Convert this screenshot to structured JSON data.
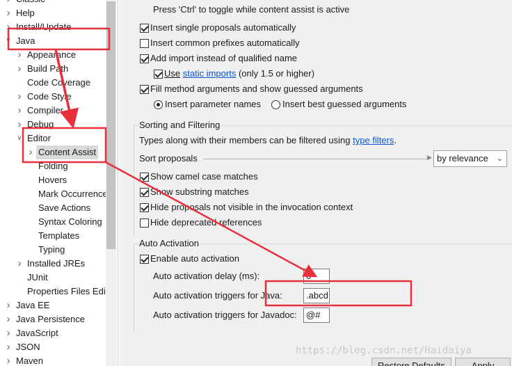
{
  "tree": {
    "items": [
      {
        "label": "Classic",
        "level": 0,
        "twisty": "collapsed"
      },
      {
        "label": "Help",
        "level": 0,
        "twisty": "collapsed"
      },
      {
        "label": "Install/Update",
        "level": 0,
        "twisty": "collapsed"
      },
      {
        "label": "Java",
        "level": 0,
        "twisty": "expanded"
      },
      {
        "label": "Appearance",
        "level": 1,
        "twisty": "collapsed"
      },
      {
        "label": "Build Path",
        "level": 1,
        "twisty": "collapsed"
      },
      {
        "label": "Code Coverage",
        "level": 1,
        "twisty": "none"
      },
      {
        "label": "Code Style",
        "level": 1,
        "twisty": "collapsed"
      },
      {
        "label": "Compiler",
        "level": 1,
        "twisty": "collapsed"
      },
      {
        "label": "Debug",
        "level": 1,
        "twisty": "collapsed"
      },
      {
        "label": "Editor",
        "level": 1,
        "twisty": "expanded"
      },
      {
        "label": "Content Assist",
        "level": 2,
        "twisty": "collapsed",
        "selected": true
      },
      {
        "label": "Folding",
        "level": 2,
        "twisty": "none"
      },
      {
        "label": "Hovers",
        "level": 2,
        "twisty": "none"
      },
      {
        "label": "Mark Occurrences",
        "level": 2,
        "twisty": "none"
      },
      {
        "label": "Save Actions",
        "level": 2,
        "twisty": "none"
      },
      {
        "label": "Syntax Coloring",
        "level": 2,
        "twisty": "none"
      },
      {
        "label": "Templates",
        "level": 2,
        "twisty": "none"
      },
      {
        "label": "Typing",
        "level": 2,
        "twisty": "none"
      },
      {
        "label": "Installed JREs",
        "level": 1,
        "twisty": "collapsed"
      },
      {
        "label": "JUnit",
        "level": 1,
        "twisty": "none"
      },
      {
        "label": "Properties Files Editor",
        "level": 1,
        "twisty": "none"
      },
      {
        "label": "Java EE",
        "level": 0,
        "twisty": "collapsed"
      },
      {
        "label": "Java Persistence",
        "level": 0,
        "twisty": "collapsed"
      },
      {
        "label": "JavaScript",
        "level": 0,
        "twisty": "collapsed"
      },
      {
        "label": "JSON",
        "level": 0,
        "twisty": "collapsed"
      },
      {
        "label": "Maven",
        "level": 0,
        "twisty": "collapsed"
      }
    ]
  },
  "insertion": {
    "hint": "Press 'Ctrl' to toggle while content assist is active",
    "single_proposals": {
      "label": "Insert single proposals automatically",
      "checked": true
    },
    "common_prefixes": {
      "label": "Insert common prefixes automatically",
      "checked": false
    },
    "add_import": {
      "label": "Add import instead of qualified name",
      "checked": true
    },
    "static_imports": {
      "prefix": "Use",
      "link": "static imports",
      "suffix": "(only 1.5 or higher)",
      "checked": true
    },
    "fill_method_args": {
      "label": "Fill method arguments and show guessed arguments",
      "checked": true
    },
    "param_names": {
      "label": "Insert parameter names",
      "selected": true
    },
    "best_guessed": {
      "label": "Insert best guessed arguments",
      "selected": false
    }
  },
  "sorting": {
    "title": "Sorting and Filtering",
    "types_text": "Types along with their members can be filtered using",
    "types_link": "type filters",
    "types_end": ".",
    "sort_label": "Sort proposals",
    "sort_value": "by relevance",
    "camel_case": {
      "label": "Show camel case matches",
      "checked": true
    },
    "substring": {
      "label": "Show substring matches",
      "checked": true
    },
    "hide_not_visible": {
      "label": "Hide proposals not visible in the invocation context",
      "checked": true
    },
    "hide_deprecated": {
      "label": "Hide deprecated references",
      "checked": false
    }
  },
  "auto_activation": {
    "title": "Auto Activation",
    "enable": {
      "label": "Enable auto activation",
      "checked": true
    },
    "delay_label": "Auto activation delay (ms):",
    "delay_value": "0",
    "java_label": "Auto activation triggers for Java:",
    "java_value": ".abcd",
    "javadoc_label": "Auto activation triggers for Javadoc:",
    "javadoc_value": "@#"
  },
  "buttons": {
    "restore_defaults": "Restore Defaults",
    "apply": "Apply"
  },
  "watermark": "https://blog.csdn.net/Haidaiya",
  "colors": {
    "annotation_red": "#e8303a",
    "link_blue": "#0b57d0",
    "selection_gray": "#d9d9d9"
  }
}
